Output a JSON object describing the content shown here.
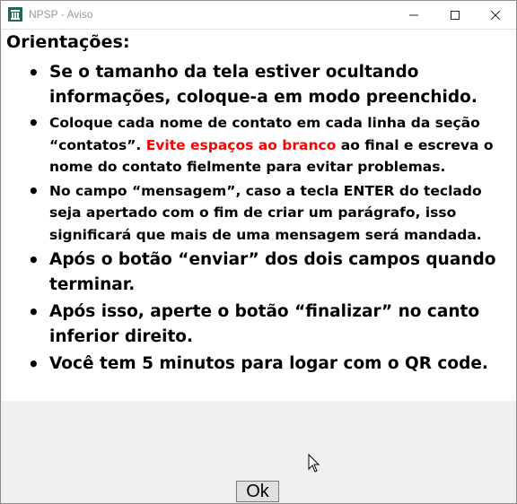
{
  "window": {
    "title": "NPSP - Aviso",
    "controls": {
      "minimize": "minimize",
      "maximize": "maximize",
      "close": "close"
    }
  },
  "content": {
    "heading": "Orientações:",
    "items": [
      {
        "text": "Se o tamanho da tela estiver ocultando informações, coloque-a em modo preenchido."
      },
      {
        "before": "Coloque cada nome de contato em cada linha da seção “contatos”. ",
        "highlight": "Evite espaços ao branco",
        "after": " ao final e escreva o nome do contato fielmente para evitar problemas.",
        "highlight_color": "#ff0000"
      },
      {
        "text": "No campo “mensagem”, caso a tecla ENTER do teclado seja apertado com o fim de criar um parágrafo, isso significará que mais de uma mensagem será mandada."
      },
      {
        "text": "Após o botão “enviar” dos dois campos quando terminar."
      },
      {
        "text": "Após isso, aperte o botão “finalizar” no canto inferior direito."
      },
      {
        "text": "Você tem 5 minutos para logar com o QR code."
      }
    ]
  },
  "buttons": {
    "ok_label": "Ok"
  }
}
